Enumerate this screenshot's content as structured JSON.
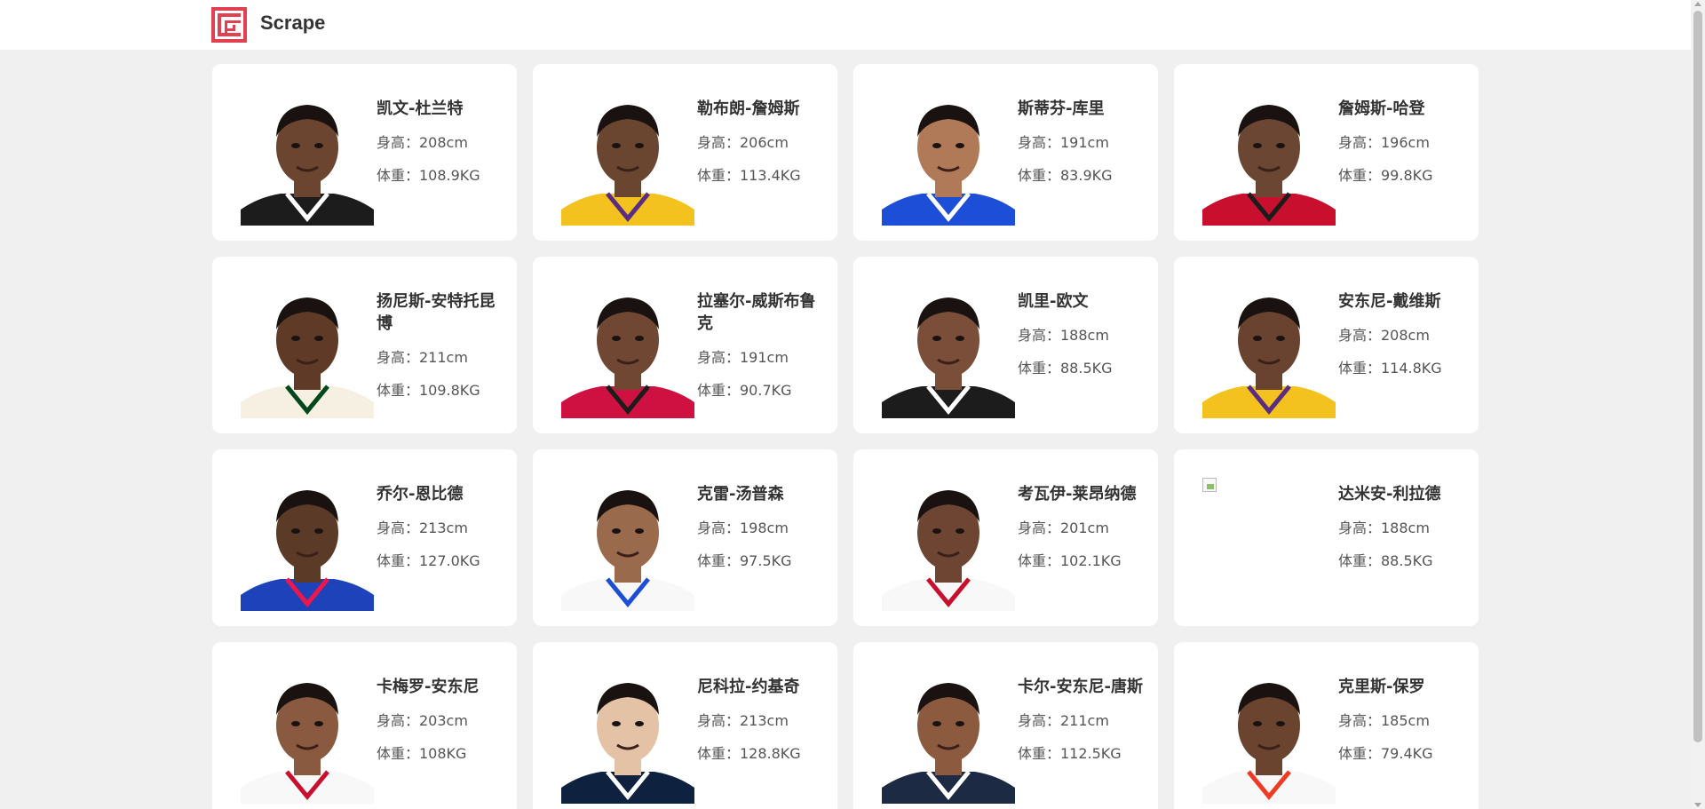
{
  "header": {
    "brand": "Scrape",
    "logo_color": "#e0404f"
  },
  "players": [
    {
      "name": "凯文-杜兰特",
      "height": "身高：208cm",
      "weight": "体重：108.9KG",
      "photo": "player-photo",
      "skin": "#6b4530",
      "jersey": "#1c1c1c",
      "trim": "#ffffff",
      "has_photo": true
    },
    {
      "name": "勒布朗-詹姆斯",
      "height": "身高：206cm",
      "weight": "体重：113.4KG",
      "photo": "player-photo",
      "skin": "#6a4530",
      "jersey": "#f3c21e",
      "trim": "#5a2d82",
      "has_photo": true
    },
    {
      "name": "斯蒂芬-库里",
      "height": "身高：191cm",
      "weight": "体重：83.9KG",
      "photo": "player-photo",
      "skin": "#b07a58",
      "jersey": "#1d4ed8",
      "trim": "#ffffff",
      "has_photo": true
    },
    {
      "name": "詹姆斯-哈登",
      "height": "身高：196cm",
      "weight": "体重：99.8KG",
      "photo": "player-photo",
      "skin": "#6b4733",
      "jersey": "#c8102e",
      "trim": "#1c1c1c",
      "has_photo": true
    },
    {
      "name": "扬尼斯-安特托昆博",
      "height": "身高：211cm",
      "weight": "体重：109.8KG",
      "photo": "player-photo",
      "skin": "#5f3b27",
      "jersey": "#f5f0e1",
      "trim": "#00471b",
      "has_photo": true
    },
    {
      "name": "拉塞尔-威斯布鲁克",
      "height": "身高：191cm",
      "weight": "体重：90.7KG",
      "photo": "player-photo",
      "skin": "#704732",
      "jersey": "#ce1141",
      "trim": "#1c1c1c",
      "has_photo": true
    },
    {
      "name": "凯里-欧文",
      "height": "身高：188cm",
      "weight": "体重：88.5KG",
      "photo": "player-photo",
      "skin": "#7a4e38",
      "jersey": "#1c1c1c",
      "trim": "#ffffff",
      "has_photo": true
    },
    {
      "name": "安东尼-戴维斯",
      "height": "身高：208cm",
      "weight": "体重：114.8KG",
      "photo": "player-photo",
      "skin": "#6a4330",
      "jersey": "#f3c21e",
      "trim": "#5a2d82",
      "has_photo": true
    },
    {
      "name": "乔尔-恩比德",
      "height": "身高：213cm",
      "weight": "体重：127.0KG",
      "photo": "player-photo",
      "skin": "#5c3a28",
      "jersey": "#1d42ba",
      "trim": "#ed174c",
      "has_photo": true
    },
    {
      "name": "克雷-汤普森",
      "height": "身高：198cm",
      "weight": "体重：97.5KG",
      "photo": "player-photo",
      "skin": "#9a6a4c",
      "jersey": "#f8f8f8",
      "trim": "#1d4ed8",
      "has_photo": true
    },
    {
      "name": "考瓦伊-莱昂纳德",
      "height": "身高：201cm",
      "weight": "体重：102.1KG",
      "photo": "player-photo",
      "skin": "#6d4532",
      "jersey": "#f8f8f8",
      "trim": "#c8102e",
      "has_photo": true
    },
    {
      "name": "达米安-利拉德",
      "height": "身高：188cm",
      "weight": "体重：88.5KG",
      "photo": "broken-image",
      "skin": "#6d4532",
      "jersey": "#ffffff",
      "trim": "#ffffff",
      "has_photo": false
    },
    {
      "name": "卡梅罗-安东尼",
      "height": "身高：203cm",
      "weight": "体重：108KG",
      "photo": "player-photo",
      "skin": "#8a5a40",
      "jersey": "#f8f8f8",
      "trim": "#c8102e",
      "has_photo": true
    },
    {
      "name": "尼科拉-约基奇",
      "height": "身高：213cm",
      "weight": "体重：128.8KG",
      "photo": "player-photo",
      "skin": "#e4c2a6",
      "jersey": "#0e2240",
      "trim": "#ffffff",
      "has_photo": true
    },
    {
      "name": "卡尔-安东尼-唐斯",
      "height": "身高：211cm",
      "weight": "体重：112.5KG",
      "photo": "player-photo",
      "skin": "#8c5a3e",
      "jersey": "#1c2a44",
      "trim": "#ffffff",
      "has_photo": true
    },
    {
      "name": "克里斯-保罗",
      "height": "身高：185cm",
      "weight": "体重：79.4KG",
      "photo": "player-photo",
      "skin": "#6b4430",
      "jersey": "#f8f8f8",
      "trim": "#ef3b24",
      "has_photo": true
    }
  ]
}
